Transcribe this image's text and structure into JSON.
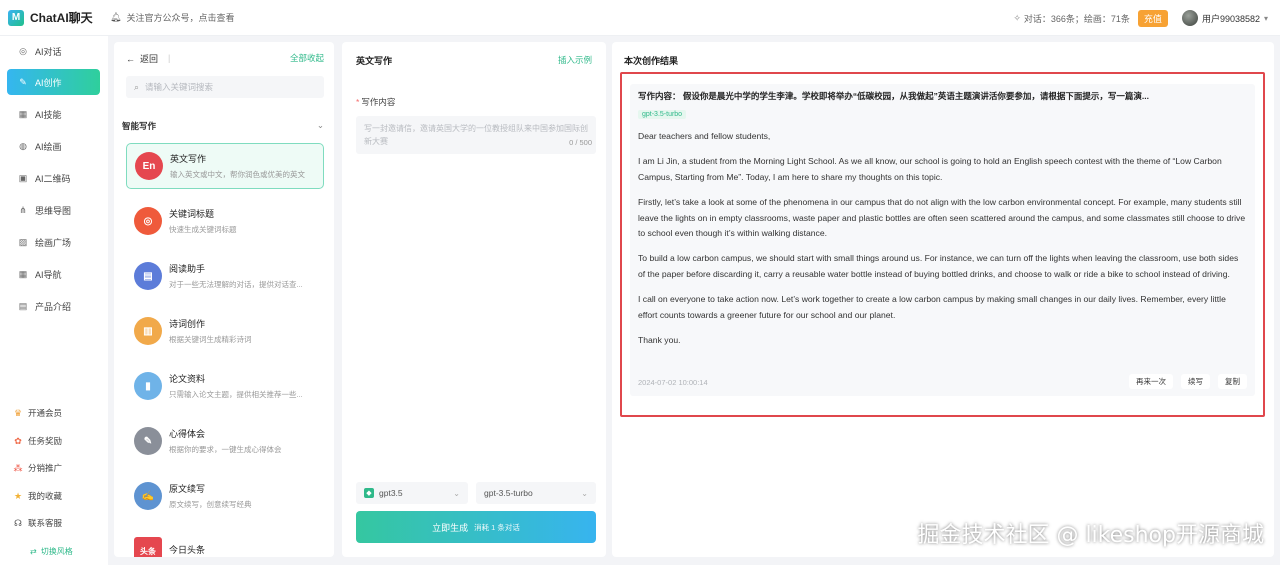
{
  "app": {
    "name": "ChatAI聊天",
    "logo_icon": "ChatAI-logo"
  },
  "topbar": {
    "notice": "关注官方公众号，点击查看",
    "usage": "对话：366条；绘画：71条",
    "recharge_label": "充值",
    "user_name": "用户99038582"
  },
  "nav": {
    "items": [
      {
        "label": "AI对话",
        "icon": "chat-icon"
      },
      {
        "label": "AI创作",
        "icon": "write-icon",
        "active": true
      },
      {
        "label": "AI技能",
        "icon": "grid-icon"
      },
      {
        "label": "AI绘画",
        "icon": "palette-icon"
      },
      {
        "label": "AI二维码",
        "icon": "qrcode-icon"
      },
      {
        "label": "思维导图",
        "icon": "mindmap-icon"
      },
      {
        "label": "绘画广场",
        "icon": "gallery-icon"
      },
      {
        "label": "AI导航",
        "icon": "grid-icon"
      },
      {
        "label": "产品介绍",
        "icon": "document-icon"
      }
    ],
    "bottom": [
      {
        "label": "开通会员",
        "icon": "vip-icon"
      },
      {
        "label": "任务奖励",
        "icon": "gift-icon"
      },
      {
        "label": "分销推广",
        "icon": "share-icon"
      },
      {
        "label": "我的收藏",
        "icon": "star-icon"
      },
      {
        "label": "联系客服",
        "icon": "headset-icon"
      }
    ],
    "switch_style": "切换风格"
  },
  "assistants": {
    "back_label": "返回",
    "collapse_label": "全部收起",
    "search_placeholder": "请输入关键词搜索",
    "category": "智能写作",
    "items": [
      {
        "title": "英文写作",
        "desc": "输入英文或中文，帮你润色或优美的英文",
        "color": "#e5474f",
        "icon_text": "En",
        "active": true
      },
      {
        "title": "关键词标题",
        "desc": "快速生成关键词标题",
        "color": "#ef5a3b",
        "icon_text": "◎"
      },
      {
        "title": "阅读助手",
        "desc": "对于一些无法理解的对话，提供对话查...",
        "color": "#5c7cd9",
        "icon_text": "▤"
      },
      {
        "title": "诗词创作",
        "desc": "根据关键词生成精彩诗词",
        "color": "#f1a94a",
        "icon_text": "▥"
      },
      {
        "title": "论文资料",
        "desc": "只需输入论文主题，提供相关推荐一些...",
        "color": "#6fb3e8",
        "icon_text": "▮"
      },
      {
        "title": "心得体会",
        "desc": "根据你的要求，一键生成心得体会",
        "color": "#8a8f99",
        "icon_text": "✎"
      },
      {
        "title": "原文续写",
        "desc": "原文续写，创意续写经典",
        "color": "#5e93d1",
        "icon_text": "✍"
      },
      {
        "title": "今日头条",
        "desc": "",
        "color": "#e5474f",
        "icon_text": "头条"
      }
    ]
  },
  "writing": {
    "title": "英文写作",
    "example_label": "插入示例",
    "field_label": "写作内容",
    "placeholder": "写一封邀请信，邀请英国大学的一位教授组队来中国参加国际创新大赛",
    "counter": "0 / 500",
    "model": "gpt3.5",
    "submodel": "gpt-3.5-turbo",
    "generate_label": "立即生成",
    "generate_cost": "消耗 1 条对话"
  },
  "result": {
    "title": "本次创作结果",
    "topic": "写作内容：  假设你是晨光中学的学生李津。学校即将举办“低碳校园，从我做起”英语主题演讲活你要参加，请根据下面提示，写一篇演...",
    "model_tag": "gpt-3.5-turbo",
    "paragraphs": [
      "Dear teachers and fellow students,",
      "I am Li Jin, a student from the Morning Light School. As we all know, our school is going to hold an English speech contest with the theme of “Low Carbon Campus, Starting from Me”. Today, I am here to share my thoughts on this topic.",
      "Firstly, let’s take a look at some of the phenomena in our campus that do not align with the low carbon environmental concept. For example, many students still leave the lights on in empty classrooms, waste paper and plastic bottles are often seen scattered around the campus, and some classmates still choose to drive to school even though it’s within walking distance.",
      "To build a low carbon campus, we should start with small things around us. For instance, we can turn off the lights when leaving the classroom, use both sides of the paper before discarding it, carry a reusable water bottle instead of buying bottled drinks, and choose to walk or ride a bike to school instead of driving.",
      "I call on everyone to take action now. Let’s work together to create a low carbon campus by making small changes in our daily lives. Remember, every little effort counts towards a greener future for our school and our planet.",
      "Thank you."
    ],
    "time": "2024-07-02 10:00:14",
    "actions": [
      "再来一次",
      "续写",
      "复制"
    ]
  },
  "watermark": "掘金技术社区 @ likeshop开源商城"
}
